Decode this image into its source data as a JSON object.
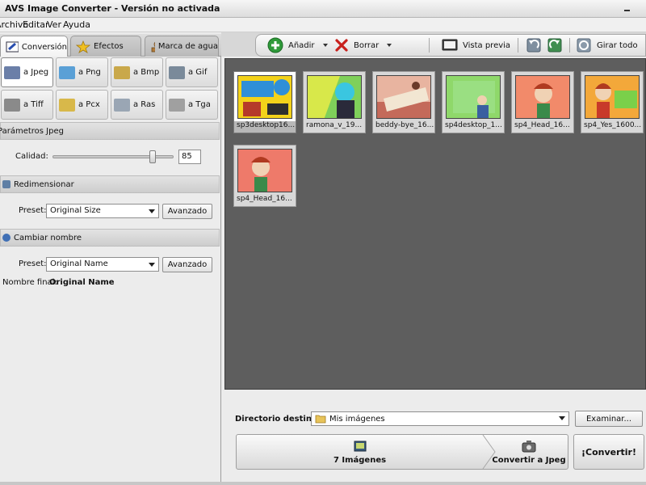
{
  "window": {
    "title": "AVS Image Converter - Versión no activada"
  },
  "menu": [
    "Archivo",
    "Editar",
    "Ver",
    "Ayuda"
  ],
  "left_tabs": [
    {
      "label": "Conversión",
      "icon": "conversion-icon",
      "active": true
    },
    {
      "label": "Efectos",
      "icon": "star-icon",
      "active": false
    },
    {
      "label": "Marca de agua",
      "icon": "watermark-icon",
      "active": false
    }
  ],
  "toolbar": {
    "add_label": "Añadir",
    "delete_label": "Borrar",
    "preview_label": "Vista previa",
    "rotate_all_label": "Girar todo"
  },
  "formats": [
    {
      "label": "a Jpeg",
      "active": true,
      "color": "#6b7fa8"
    },
    {
      "label": "a Png",
      "active": false,
      "color": "#5aa0d6"
    },
    {
      "label": "a Bmp",
      "active": false,
      "color": "#c9a84a"
    },
    {
      "label": "a Gif",
      "active": false,
      "color": "#7a8a9a"
    },
    {
      "label": "a Tiff",
      "active": false,
      "color": "#8a8a8a"
    },
    {
      "label": "a Pcx",
      "active": false,
      "color": "#d8b84a"
    },
    {
      "label": "a Ras",
      "active": false,
      "color": "#9aa6b4"
    },
    {
      "label": "a Tga",
      "active": false,
      "color": "#a0a0a0"
    }
  ],
  "jpeg_params": {
    "title": "Parámetros Jpeg",
    "quality_label": "Calidad:",
    "quality_value": "85",
    "quality_fraction": 0.85
  },
  "resize": {
    "title": "Redimensionar",
    "preset_label": "Preset:",
    "preset_value": "Original Size",
    "advanced_label": "Avanzado"
  },
  "rename": {
    "title": "Cambiar nombre",
    "preset_label": "Preset:",
    "preset_value": "Original Name",
    "advanced_label": "Avanzado",
    "final_name_label": "Nombre final:",
    "final_name_value": "Original Name"
  },
  "thumbnails": [
    {
      "caption": "sp3desktop16...",
      "selected": true
    },
    {
      "caption": "ramona_v_19...",
      "selected": false
    },
    {
      "caption": "beddy-bye_16...",
      "selected": false
    },
    {
      "caption": "sp4desktop_1...",
      "selected": false
    },
    {
      "caption": "sp4_Head_16...",
      "selected": false
    },
    {
      "caption": "sp4_Yes_1600...",
      "selected": false
    },
    {
      "caption": "sp4_Head_16...",
      "selected": false
    }
  ],
  "destination": {
    "label": "Directorio destino",
    "value": "Mis imágenes",
    "browse_label": "Examinar..."
  },
  "steps": {
    "images_label": "7 Imágenes",
    "convert_to_label": "Convertir a Jpeg"
  },
  "convert_button_label": "¡Convertir!"
}
